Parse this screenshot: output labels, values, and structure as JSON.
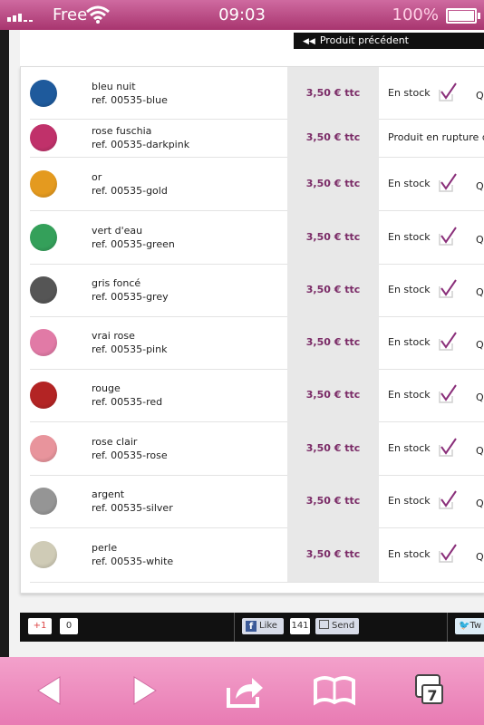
{
  "status_bar": {
    "carrier": "Free",
    "time": "09:03",
    "battery": "100%"
  },
  "nav": {
    "prev_label": "Produit précédent"
  },
  "products": [
    {
      "name": "bleu nuit",
      "ref": "ref. 00535-blue",
      "price": "3,50 € ttc",
      "stock": "En stock",
      "qty": "Q",
      "color": "#1e5a9c",
      "in_stock": true
    },
    {
      "name": "rose fuschia",
      "ref": "ref. 00535-darkpink",
      "price": "3,50 € ttc",
      "stock": "Produit en rupture d",
      "qty": "",
      "color": "#c0316a",
      "in_stock": false
    },
    {
      "name": "or",
      "ref": "ref. 00535-gold",
      "price": "3,50 € ttc",
      "stock": "En stock",
      "qty": "Q",
      "color": "#e49a1f",
      "in_stock": true
    },
    {
      "name": "vert d'eau",
      "ref": "ref. 00535-green",
      "price": "3,50 € ttc",
      "stock": "En stock",
      "qty": "Q",
      "color": "#34a05a",
      "in_stock": true
    },
    {
      "name": "gris foncé",
      "ref": "ref. 00535-grey",
      "price": "3,50 € ttc",
      "stock": "En stock",
      "qty": "Q",
      "color": "#555555",
      "in_stock": true
    },
    {
      "name": "vrai rose",
      "ref": "ref. 00535-pink",
      "price": "3,50 € ttc",
      "stock": "En stock",
      "qty": "Q",
      "color": "#e17aa6",
      "in_stock": true
    },
    {
      "name": "rouge",
      "ref": "ref. 00535-red",
      "price": "3,50 € ttc",
      "stock": "En stock",
      "qty": "Q",
      "color": "#b32424",
      "in_stock": true
    },
    {
      "name": "rose clair",
      "ref": "ref. 00535-rose",
      "price": "3,50 € ttc",
      "stock": "En stock",
      "qty": "Q",
      "color": "#e8949c",
      "in_stock": true
    },
    {
      "name": "argent",
      "ref": "ref. 00535-silver",
      "price": "3,50 € ttc",
      "stock": "En stock",
      "qty": "Q",
      "color": "#959595",
      "in_stock": true
    },
    {
      "name": "perle",
      "ref": "ref. 00535-white",
      "price": "3,50 € ttc",
      "stock": "En stock",
      "qty": "Q",
      "color": "#cfcbb6",
      "in_stock": true
    }
  ],
  "social": {
    "gplus_label": "+1",
    "gplus_count": "0",
    "fb_like": "Like",
    "fb_count": "141",
    "fb_send": "Send",
    "tweet": "Tw"
  },
  "toolbar": {
    "tab_count": "7"
  },
  "colors": {
    "accent": "#7a2a66",
    "toolbar": "#f3a1cb",
    "status_bar": "#b94a86"
  }
}
